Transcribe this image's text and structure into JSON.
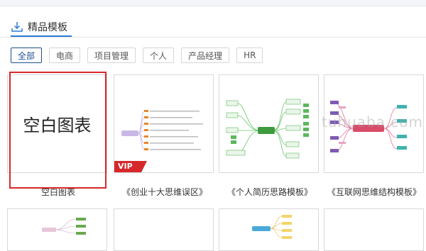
{
  "section": {
    "title": "精品模板"
  },
  "tabs": [
    {
      "label": "全部",
      "active": true
    },
    {
      "label": "电商",
      "active": false
    },
    {
      "label": "项目管理",
      "active": false
    },
    {
      "label": "个人",
      "active": false
    },
    {
      "label": "产品经理",
      "active": false
    },
    {
      "label": "HR",
      "active": false
    }
  ],
  "templates": [
    {
      "preview_text": "空白图表",
      "label": "空白图表",
      "vip": false
    },
    {
      "preview_text": "",
      "label": "《创业十大思维误区》",
      "vip": true,
      "vip_text": "VIP"
    },
    {
      "preview_text": "",
      "label": "《个人简历思路模板》",
      "vip": false
    },
    {
      "preview_text": "",
      "label": "《互联网思维结构模板》",
      "vip": false
    }
  ],
  "watermark": "tuhuaba.com",
  "colors": {
    "accent": "#2b7bd6",
    "active_tab": "#1e4f8f",
    "highlight": "#d6282b",
    "vip": "#d6282b"
  }
}
